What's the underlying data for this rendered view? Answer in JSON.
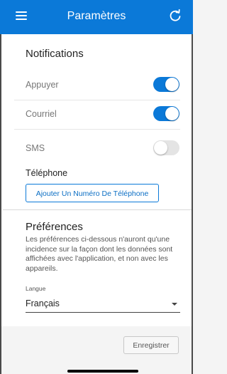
{
  "header": {
    "title": "Paramètres",
    "menu_icon": "hamburger-menu-icon",
    "refresh_icon": "refresh-icon",
    "background_color": "#0b79d8"
  },
  "notifications": {
    "title": "Notifications",
    "rows": [
      {
        "label": "Appuyer",
        "enabled": true
      },
      {
        "label": "Courriel",
        "enabled": true
      },
      {
        "label": "SMS",
        "enabled": false
      }
    ],
    "phone_label": "Téléphone",
    "add_phone_button": "Ajouter Un Numéro De Téléphone"
  },
  "preferences": {
    "title": "Préférences",
    "description": "Les préférences ci-dessous n'auront qu'une incidence sur la façon dont les données sont affichées avec l'application, et non avec les appareils.",
    "language_label": "Langue",
    "language_value": "Français"
  },
  "footer": {
    "save_button": "Enregistrer"
  }
}
